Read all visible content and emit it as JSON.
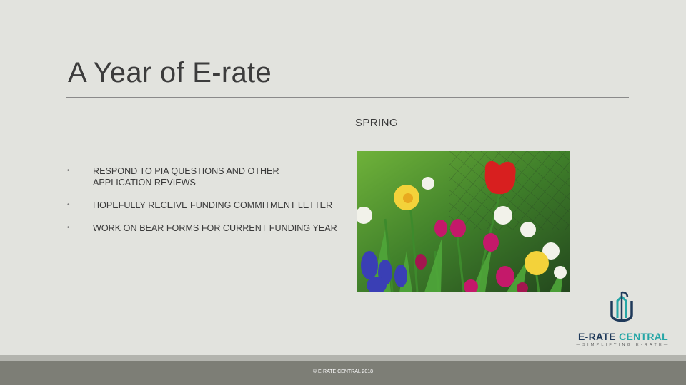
{
  "slide": {
    "title": "A Year of E-rate",
    "section_heading": "SPRING",
    "bullets": [
      "RESPOND TO PIA QUESTIONS AND OTHER APPLICATION REVIEWS",
      "HOPEFULLY RECEIVE FUNDING COMMITMENT LETTER",
      "WORK ON BEAR FORMS FOR CURRENT FUNDING YEAR"
    ],
    "bullet_symbol": "•"
  },
  "logo": {
    "name_part1": "E-RATE ",
    "name_part2": "CENTRAL",
    "tagline": "—SIMPLIFYING E-RATE—",
    "primary_color": "#1f3a5a",
    "accent_color": "#25a6a6"
  },
  "footer": {
    "copyright": "© E-RATE CENTRAL 2018"
  },
  "colors": {
    "background": "#e2e3de",
    "footer_bar": "#7d7e76"
  },
  "icons": {
    "photo": "spring-flowers-photo",
    "logo_mark": "e-rate-central-logo-mark"
  }
}
